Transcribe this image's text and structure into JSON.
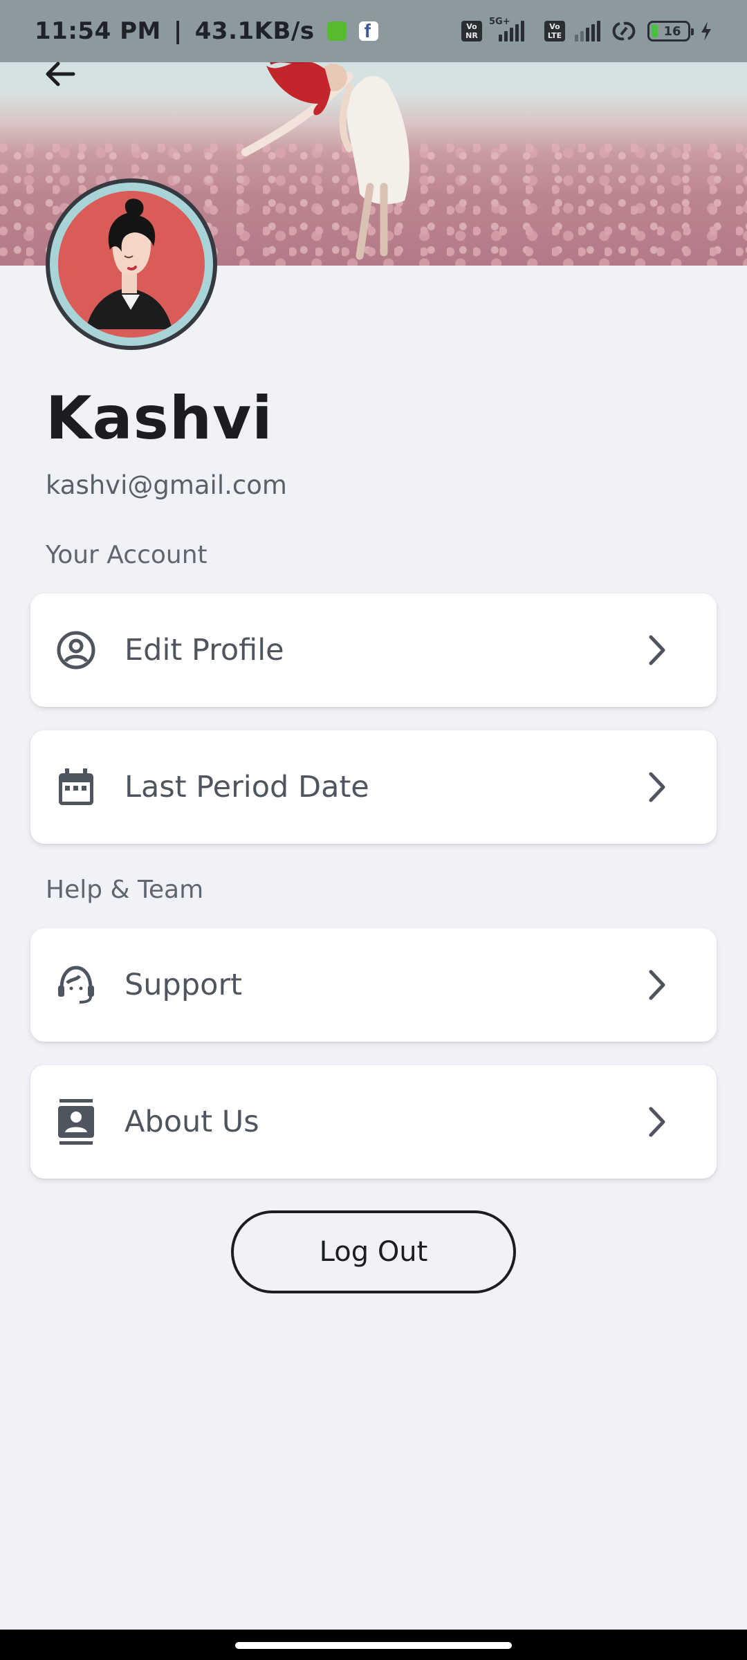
{
  "status_bar": {
    "time": "11:54 PM",
    "separator": "|",
    "net_speed": "43.1KB/s",
    "network_type": "5G+",
    "volte1": [
      "Vo",
      "NR"
    ],
    "volte2": [
      "Vo",
      "LTE"
    ],
    "battery_level": "16",
    "icons": [
      "android-notification-icon",
      "facebook-icon",
      "volte-nr-icon",
      "signal-5g-icon",
      "volte-lte-icon",
      "signal-icon",
      "hotspot-link-icon",
      "battery-icon",
      "charging-bolt-icon"
    ]
  },
  "header": {
    "back_icon": "arrow-left-icon"
  },
  "profile": {
    "name": "Kashvi",
    "email": "kashvi@gmail.com"
  },
  "sections": {
    "account_label": "Your Account",
    "help_label": "Help & Team"
  },
  "menu": {
    "edit_profile": {
      "label": "Edit Profile",
      "icon": "account-circle-icon"
    },
    "last_period": {
      "label": "Last Period Date",
      "icon": "calendar-icon"
    },
    "support": {
      "label": "Support",
      "icon": "headset-support-icon"
    },
    "about_us": {
      "label": "About Us",
      "icon": "contact-card-icon"
    }
  },
  "logout": {
    "label": "Log Out"
  },
  "colors": {
    "background": "#f0f2f7",
    "card": "#ffffff",
    "text_primary": "#1b1d21",
    "text_secondary": "#4e555e",
    "avatar_ring": "#a8d4d7",
    "avatar_bg": "#d95c58"
  }
}
